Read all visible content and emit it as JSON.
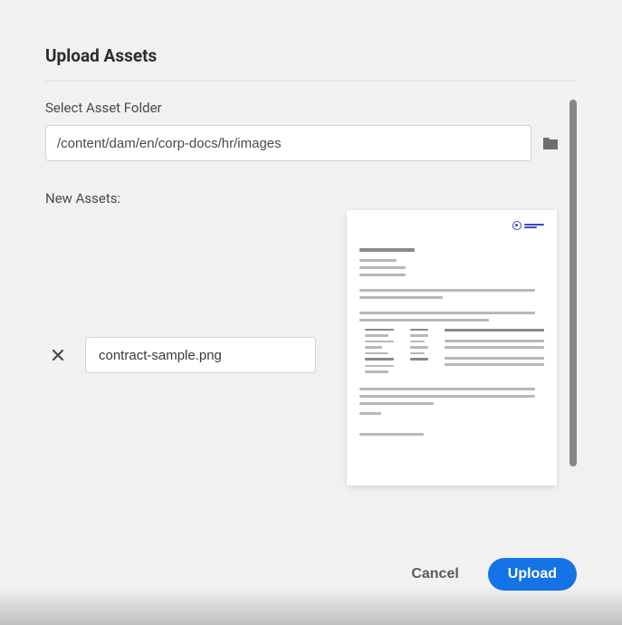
{
  "dialog": {
    "title": "Upload Assets",
    "folder": {
      "label": "Select Asset Folder",
      "value": "/content/dam/en/corp-docs/hr/images"
    },
    "new_assets": {
      "label": "New Assets:",
      "items": [
        {
          "filename": "contract-sample.png"
        }
      ]
    },
    "actions": {
      "cancel": "Cancel",
      "upload": "Upload"
    }
  }
}
